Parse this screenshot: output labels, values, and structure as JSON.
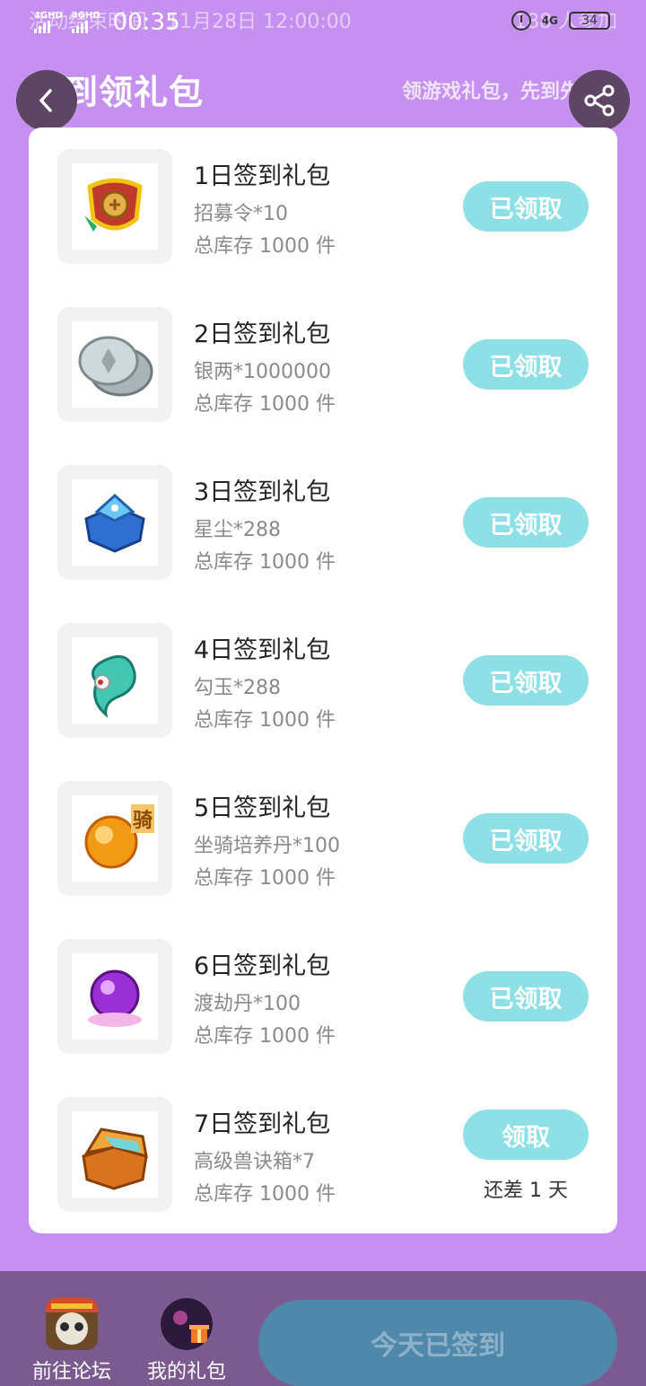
{
  "status_bar": {
    "network_left": "4GHD",
    "network_right": "4GHD",
    "time": "00:35",
    "network_type": "4G",
    "battery": "34",
    "under_label": "活动结束时间",
    "under_datetime": "11月28日 12:00:00",
    "under_participants": "188 人参加"
  },
  "header": {
    "title": "签到领礼包",
    "subtitle": "领游戏礼包，先到先得"
  },
  "rewards": [
    {
      "title": "1日签到礼包",
      "item": "招募令*10",
      "stock": "总库存 1000 件",
      "button": "已领取",
      "icon": "recruit-token-icon"
    },
    {
      "title": "2日签到礼包",
      "item": "银两*1000000",
      "stock": "总库存 1000 件",
      "button": "已领取",
      "icon": "silver-coin-icon"
    },
    {
      "title": "3日签到礼包",
      "item": "星尘*288",
      "stock": "总库存 1000 件",
      "button": "已领取",
      "icon": "stardust-chest-icon"
    },
    {
      "title": "4日签到礼包",
      "item": "勾玉*288",
      "stock": "总库存 1000 件",
      "button": "已领取",
      "icon": "magatama-icon"
    },
    {
      "title": "5日签到礼包",
      "item": "坐骑培养丹*100",
      "stock": "总库存 1000 件",
      "button": "已领取",
      "icon": "mount-pill-icon",
      "badge": "骑"
    },
    {
      "title": "6日签到礼包",
      "item": "渡劫丹*100",
      "stock": "总库存 1000 件",
      "button": "已领取",
      "icon": "tribulation-pill-icon"
    },
    {
      "title": "7日签到礼包",
      "item": "高级兽诀箱*7",
      "stock": "总库存 1000 件",
      "button": "领取",
      "remaining": "还差 1 天",
      "icon": "treasure-chest-icon"
    }
  ],
  "bottom_bar": {
    "forum_label": "前往论坛",
    "gifts_label": "我的礼包",
    "signin_label": "今天已签到"
  },
  "colors": {
    "background": "#c590ef",
    "button_teal": "#8de0e6",
    "bottom_bar": "#7b5b8f",
    "signin_button": "#4f88ab"
  }
}
